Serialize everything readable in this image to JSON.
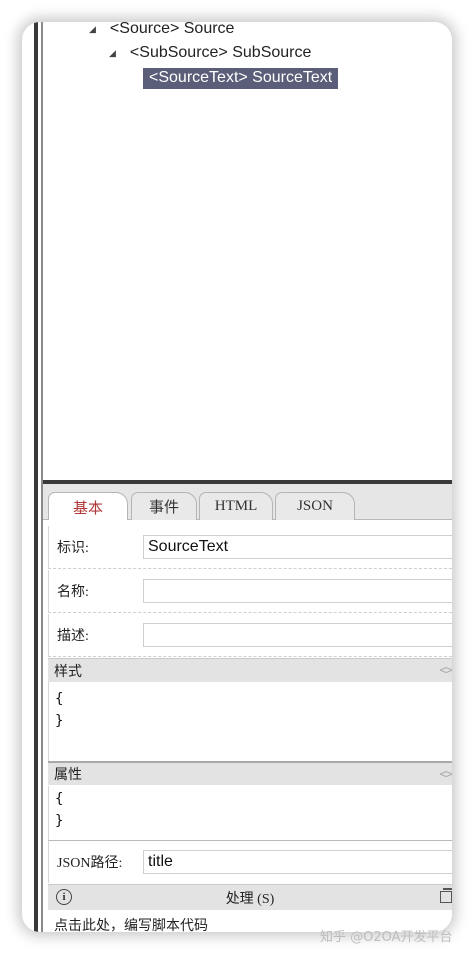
{
  "tree": {
    "nodes": [
      {
        "expander": "◢",
        "label": "<Source> Source"
      },
      {
        "expander": "◢",
        "label": "<SubSource> SubSource"
      },
      {
        "label": "<SourceText> SourceText",
        "selected": true
      }
    ]
  },
  "tabs": [
    {
      "label": "基本",
      "active": true
    },
    {
      "label": "事件"
    },
    {
      "label": "HTML"
    },
    {
      "label": "JSON"
    }
  ],
  "form": {
    "id_label": "标识:",
    "id_value": "SourceText",
    "name_label": "名称:",
    "name_value": "",
    "desc_label": "描述:",
    "desc_value": "",
    "style_label": "样式",
    "style_code": [
      "{",
      "}"
    ],
    "attr_label": "属性",
    "attr_code": [
      "{",
      "}"
    ],
    "jsonpath_label": "JSON路径:",
    "jsonpath_value": "title",
    "process_label": "处理 (S)",
    "script_hint": "点击此处，编写脚本代码"
  },
  "icons": {
    "code_icon": "<>",
    "info_icon": "i"
  },
  "watermark": "知乎 @O2OA开发平台",
  "colors": {
    "selection_bg": "#5a5e78",
    "active_tab_text": "#b03a3a"
  }
}
